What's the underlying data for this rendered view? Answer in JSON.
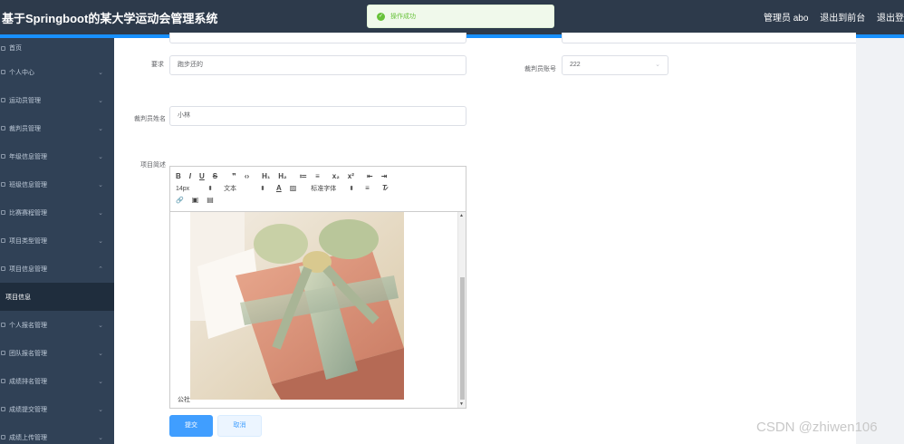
{
  "header": {
    "title": "基于Springboot的某大学运动会管理系统",
    "admin_label": "管理员 abo",
    "front_link": "退出到前台",
    "logout_link": "退出登"
  },
  "toast": {
    "message": "操作成功"
  },
  "sidebar": {
    "items": [
      {
        "label": "首页",
        "expandable": false
      },
      {
        "label": "个人中心",
        "expandable": true
      },
      {
        "label": "运动员管理",
        "expandable": true
      },
      {
        "label": "裁判员管理",
        "expandable": true
      },
      {
        "label": "年级信息管理",
        "expandable": true
      },
      {
        "label": "班级信息管理",
        "expandable": true
      },
      {
        "label": "比赛赛程管理",
        "expandable": true
      },
      {
        "label": "项目类型管理",
        "expandable": true
      },
      {
        "label": "项目信息管理",
        "expandable": true
      },
      {
        "label": "项目信息",
        "expandable": false,
        "sub": true
      },
      {
        "label": "个人报名管理",
        "expandable": true
      },
      {
        "label": "团队报名管理",
        "expandable": true
      },
      {
        "label": "成绩排名管理",
        "expandable": true
      },
      {
        "label": "成绩提交管理",
        "expandable": true
      },
      {
        "label": "成绩上传管理",
        "expandable": true
      }
    ]
  },
  "form": {
    "requirement_label": "要求",
    "requirement_value": "跑步还的",
    "referee_no_label": "裁判员账号",
    "referee_no_value": "222",
    "referee_name_label": "裁判员姓名",
    "referee_name_value": "小林",
    "desc_label": "项目简述",
    "editor_caption": "公社",
    "submit_label": "提交",
    "cancel_label": "取消"
  },
  "editor_toolbar": {
    "row1": [
      "B",
      "I",
      "U",
      "S",
      "❞",
      "‹›",
      "H₁",
      "H₂",
      "≔",
      "≡",
      "x₂",
      "x²",
      "⇤",
      "⇥"
    ],
    "size_label": "14px",
    "text_label": "文本",
    "font_label": "标准字体",
    "row3": [
      "🔗",
      "▣",
      "▤"
    ]
  },
  "watermark": "CSDN @zhiwen106"
}
